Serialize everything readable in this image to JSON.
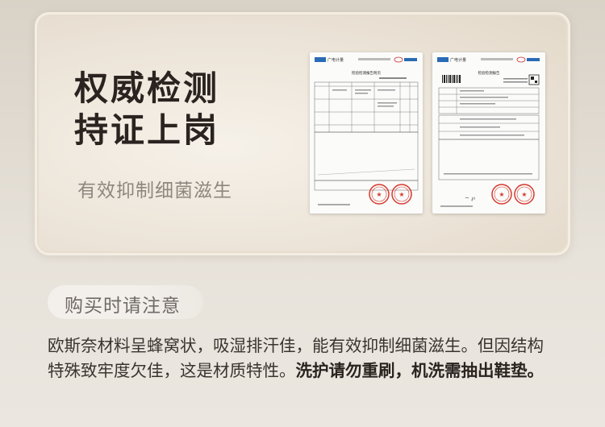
{
  "headline": {
    "line1": "权威检测",
    "line2": "持证上岗"
  },
  "subtitle": "有效抑制细菌滋生",
  "reports": [
    {
      "header_left": "广电计量",
      "title": "检验检测报告附页"
    },
    {
      "header_left": "广电计量",
      "title": "检验检测报告"
    }
  ],
  "notice": {
    "label": "购买时请注意",
    "text_line1": "欧斯奈材料呈蜂窝状，吸湿排汗佳，能有效抑制细菌滋生。但因结构",
    "text_line2_plain": "特殊致牢度欠佳，这是材质特性。",
    "text_line2_bold": "洗护请勿重刷，机洗需抽出鞋垫。"
  },
  "colors": {
    "stamp_red": "#d63a2f",
    "logo_blue": "#2a6bb5"
  }
}
